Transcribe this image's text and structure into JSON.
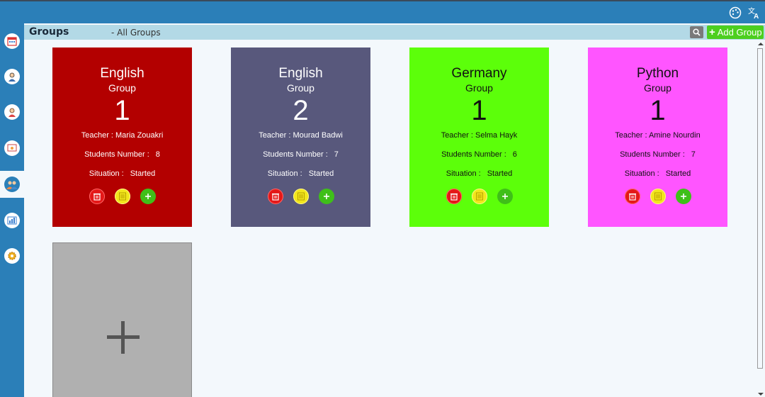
{
  "header": {
    "title": "Groups",
    "subtitle": "- All Groups",
    "add_label": "Add Group"
  },
  "topbar": {
    "icons": [
      "palette-icon",
      "translate-icon"
    ]
  },
  "sidebar": {
    "items": [
      {
        "name": "calendar-icon",
        "active": false
      },
      {
        "name": "teacher-icon",
        "active": false
      },
      {
        "name": "students-icon",
        "active": false
      },
      {
        "name": "classroom-icon",
        "active": false
      },
      {
        "name": "groups-icon",
        "active": true
      },
      {
        "name": "statistics-icon",
        "active": false
      },
      {
        "name": "settings-icon",
        "active": false
      }
    ]
  },
  "cards": [
    {
      "name": "English",
      "group_label": "Group",
      "number": "1",
      "teacher_label": "Teacher : Maria Zouakri",
      "students_label": "Students Number :",
      "students_value": "8",
      "situation_label": "Situation :",
      "situation_value": "Started",
      "color": "#b30000",
      "text": "light"
    },
    {
      "name": "English",
      "group_label": "Group",
      "number": "2",
      "teacher_label": "Teacher : Mourad Badwi",
      "students_label": "Students Number :",
      "students_value": "7",
      "situation_label": "Situation :",
      "situation_value": "Started",
      "color": "#58587c",
      "text": "light"
    },
    {
      "name": "Germany",
      "group_label": "Group",
      "number": "1",
      "teacher_label": "Teacher : Selma Hayk",
      "students_label": "Students Number :",
      "students_value": "6",
      "situation_label": "Situation :",
      "situation_value": "Started",
      "color": "#5cff0a",
      "text": "dark"
    },
    {
      "name": "Python",
      "group_label": "Group",
      "number": "1",
      "teacher_label": "Teacher : Amine Nourdin",
      "students_label": "Students Number :",
      "students_value": "7",
      "situation_label": "Situation :",
      "situation_value": "Started",
      "color": "#ff55ff",
      "text": "dark"
    }
  ],
  "new_card": {
    "icon": "plus-icon",
    "color": "#b0b0b0"
  },
  "colors": {
    "topbar": "#2b7fb8",
    "header": "#b3d9e6",
    "add_button": "#4ccf1f"
  }
}
